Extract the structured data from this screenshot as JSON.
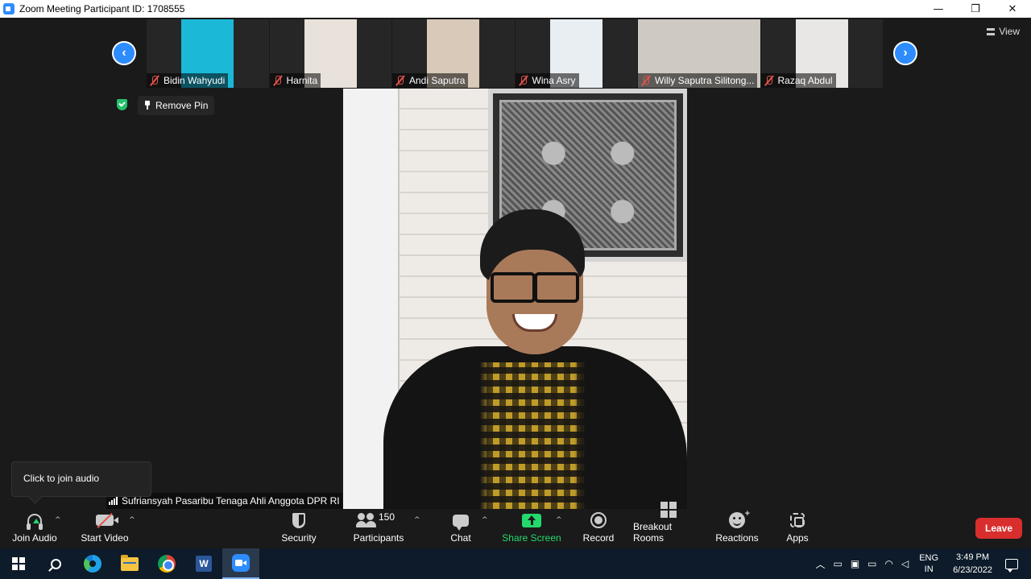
{
  "window": {
    "title": "Zoom Meeting Participant ID: 1708555",
    "minimize": "—",
    "restore": "❐",
    "close": "✕"
  },
  "thumbnails": [
    {
      "name": "Bidin Wahyudi",
      "bg": "#1bb8d8"
    },
    {
      "name": "Harnita",
      "bg": "#e8e2db"
    },
    {
      "name": "Andi Saputra",
      "bg": "#d8c9b8"
    },
    {
      "name": "Wina Asry",
      "bg": "#e9eef2"
    },
    {
      "name": "Willy Saputra Silitong...",
      "bg": "#cfc9c3"
    },
    {
      "name": "Razaq Abdul",
      "bg": "#e9e7e5"
    }
  ],
  "nav": {
    "prev": "‹",
    "next": "›"
  },
  "view": {
    "label": "View"
  },
  "pin": {
    "label": "Remove Pin"
  },
  "main_speaker": {
    "name": "Sufriansyah Pasaribu Tenaga Ahli Anggota DPR RI"
  },
  "tooltip": {
    "text": "Click to join audio"
  },
  "toolbar": {
    "join_audio": "Join Audio",
    "start_video": "Start Video",
    "security": "Security",
    "participants": "Participants",
    "participant_count": "150",
    "chat": "Chat",
    "share_screen": "Share Screen",
    "record": "Record",
    "breakout_rooms": "Breakout Rooms",
    "reactions": "Reactions",
    "apps": "Apps",
    "leave": "Leave",
    "caret": "^"
  },
  "taskbar": {
    "word_letter": "W",
    "tray_chevron": "︿",
    "lang_line1": "ENG",
    "lang_line2": "IN",
    "time": "3:49 PM",
    "date": "6/23/2022"
  },
  "colors": {
    "accent": "#2d8cff",
    "share_green": "#23d96c",
    "leave_red": "#d92e2e",
    "muted_red": "#e5534b"
  }
}
